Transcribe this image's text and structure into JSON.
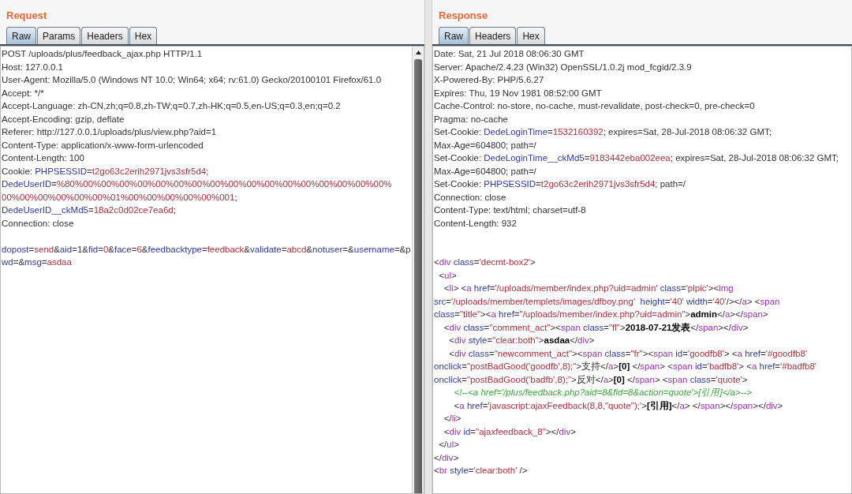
{
  "panels": [
    {
      "title": "Request",
      "has_scrollbar": true,
      "tabs": [
        {
          "label": "Raw",
          "selected": true
        },
        {
          "label": "Params",
          "selected": false
        },
        {
          "label": "Headers",
          "selected": false
        },
        {
          "label": "Hex",
          "selected": false
        }
      ],
      "lines": [
        {
          "kind": "code",
          "segments": [
            {
              "kind": "plain",
              "text": "POST /uploads/plus/feedback_ajax.php HTTP/1.1"
            }
          ]
        },
        {
          "kind": "code",
          "segments": [
            {
              "kind": "plain",
              "text": "Host: 127.0.0.1"
            }
          ]
        },
        {
          "kind": "code",
          "segments": [
            {
              "kind": "plain",
              "text": "User-Agent: Mozilla/5.0 (Windows NT 10.0; Win64; x64; rv:61.0) Gecko/20100101 Firefox/61.0"
            }
          ]
        },
        {
          "kind": "code",
          "segments": [
            {
              "kind": "plain",
              "text": "Accept: */*"
            }
          ]
        },
        {
          "kind": "code",
          "segments": [
            {
              "kind": "plain",
              "text": "Accept-Language: zh-CN,zh;q=0.8,zh-TW;q=0.7,zh-HK;q=0.5,en-US;q=0.3,en;q=0.2"
            }
          ]
        },
        {
          "kind": "code",
          "segments": [
            {
              "kind": "plain",
              "text": "Accept-Encoding: gzip, deflate"
            }
          ]
        },
        {
          "kind": "code",
          "segments": [
            {
              "kind": "plain",
              "text": "Referer: http://127.0.0.1/uploads/plus/view.php?aid=1"
            }
          ]
        },
        {
          "kind": "code",
          "segments": [
            {
              "kind": "plain",
              "text": "Content-Type: application/x-www-form-urlencoded"
            }
          ]
        },
        {
          "kind": "code",
          "segments": [
            {
              "kind": "plain",
              "text": "Content-Length: 100"
            }
          ]
        },
        {
          "kind": "code",
          "segments": [
            {
              "kind": "plain",
              "text": "Cookie: "
            },
            {
              "kind": "name",
              "text": "PHPSESSID"
            },
            {
              "kind": "plain",
              "text": "="
            },
            {
              "kind": "value",
              "text": "t2go63c2erih2971jvs3sfr5d4"
            },
            {
              "kind": "plain",
              "text": ";"
            }
          ]
        },
        {
          "kind": "code",
          "segments": [
            {
              "kind": "name",
              "text": "DedeUserID"
            },
            {
              "kind": "plain",
              "text": "="
            },
            {
              "kind": "value",
              "text": "%80%00%00%00%00%00%00%00%00%00%00%00%00%00%00%00%00%00%"
            }
          ]
        },
        {
          "kind": "code",
          "segments": [
            {
              "kind": "value",
              "text": "00%00%00%00%00%00%01%00%00%00%00%00%001"
            },
            {
              "kind": "plain",
              "text": ";"
            }
          ]
        },
        {
          "kind": "code",
          "segments": [
            {
              "kind": "name",
              "text": "DedeUserID__ckMd5"
            },
            {
              "kind": "plain",
              "text": "="
            },
            {
              "kind": "value",
              "text": "18a2c0d02ce7ea6d"
            },
            {
              "kind": "plain",
              "text": ";"
            }
          ]
        },
        {
          "kind": "code",
          "segments": [
            {
              "kind": "plain",
              "text": "Connection: close"
            }
          ]
        },
        {
          "kind": "blank"
        },
        {
          "kind": "code",
          "segments": [
            {
              "kind": "name",
              "text": "dopost"
            },
            {
              "kind": "plain",
              "text": "="
            },
            {
              "kind": "value",
              "text": "send"
            },
            {
              "kind": "plain",
              "text": "&"
            },
            {
              "kind": "name",
              "text": "aid"
            },
            {
              "kind": "plain",
              "text": "=1&"
            },
            {
              "kind": "name",
              "text": "fid"
            },
            {
              "kind": "plain",
              "text": "="
            },
            {
              "kind": "value",
              "text": "0"
            },
            {
              "kind": "plain",
              "text": "&"
            },
            {
              "kind": "name",
              "text": "face"
            },
            {
              "kind": "plain",
              "text": "="
            },
            {
              "kind": "value",
              "text": "6"
            },
            {
              "kind": "plain",
              "text": "&"
            },
            {
              "kind": "name",
              "text": "feedbacktype"
            },
            {
              "kind": "plain",
              "text": "="
            },
            {
              "kind": "value",
              "text": "feedback"
            },
            {
              "kind": "plain",
              "text": "&"
            },
            {
              "kind": "name",
              "text": "validate"
            },
            {
              "kind": "plain",
              "text": "="
            },
            {
              "kind": "value",
              "text": "abcd"
            },
            {
              "kind": "plain",
              "text": "&"
            },
            {
              "kind": "name",
              "text": "notuser"
            },
            {
              "kind": "plain",
              "text": "=&"
            },
            {
              "kind": "name",
              "text": "username"
            },
            {
              "kind": "plain",
              "text": "=&"
            },
            {
              "kind": "name",
              "text": "p"
            }
          ]
        },
        {
          "kind": "code",
          "segments": [
            {
              "kind": "name",
              "text": "wd"
            },
            {
              "kind": "plain",
              "text": "=&"
            },
            {
              "kind": "name",
              "text": "msg"
            },
            {
              "kind": "plain",
              "text": "="
            },
            {
              "kind": "value",
              "text": "asdaa"
            }
          ]
        }
      ]
    },
    {
      "title": "Response",
      "has_scrollbar": false,
      "tabs": [
        {
          "label": "Raw",
          "selected": true
        },
        {
          "label": "Headers",
          "selected": false
        },
        {
          "label": "Hex",
          "selected": false
        }
      ],
      "lines": [
        {
          "kind": "code",
          "segments": [
            {
              "kind": "plain",
              "text": "Date: Sat, 21 Jul 2018 08:06:30 GMT"
            }
          ]
        },
        {
          "kind": "code",
          "segments": [
            {
              "kind": "plain",
              "text": "Server: Apache/2.4.23 (Win32) OpenSSL/1.0.2j mod_fcgid/2.3.9"
            }
          ]
        },
        {
          "kind": "code",
          "segments": [
            {
              "kind": "plain",
              "text": "X-Powered-By: PHP/5.6.27"
            }
          ]
        },
        {
          "kind": "code",
          "segments": [
            {
              "kind": "plain",
              "text": "Expires: Thu, 19 Nov 1981 08:52:00 GMT"
            }
          ]
        },
        {
          "kind": "code",
          "segments": [
            {
              "kind": "plain",
              "text": "Cache-Control: no-store, no-cache, must-revalidate, post-check=0, pre-check=0"
            }
          ]
        },
        {
          "kind": "code",
          "segments": [
            {
              "kind": "plain",
              "text": "Pragma: no-cache"
            }
          ]
        },
        {
          "kind": "code",
          "segments": [
            {
              "kind": "plain",
              "text": "Set-Cookie: "
            },
            {
              "kind": "name",
              "text": "DedeLoginTime"
            },
            {
              "kind": "plain",
              "text": "="
            },
            {
              "kind": "value",
              "text": "1532160392"
            },
            {
              "kind": "plain",
              "text": "; expires=Sat, 28-Jul-2018 08:06:32 GMT;"
            }
          ]
        },
        {
          "kind": "code",
          "segments": [
            {
              "kind": "plain",
              "text": "Max-Age=604800; path=/"
            }
          ]
        },
        {
          "kind": "code",
          "segments": [
            {
              "kind": "plain",
              "text": "Set-Cookie: "
            },
            {
              "kind": "name",
              "text": "DedeLoginTime__ckMd5"
            },
            {
              "kind": "plain",
              "text": "="
            },
            {
              "kind": "value",
              "text": "9183442eba002eea"
            },
            {
              "kind": "plain",
              "text": "; expires=Sat, 28-Jul-2018 08:06:32 GMT;"
            }
          ]
        },
        {
          "kind": "code",
          "segments": [
            {
              "kind": "plain",
              "text": "Max-Age=604800; path=/"
            }
          ]
        },
        {
          "kind": "code",
          "segments": [
            {
              "kind": "plain",
              "text": "Set-Cookie: "
            },
            {
              "kind": "name",
              "text": "PHPSESSID"
            },
            {
              "kind": "plain",
              "text": "="
            },
            {
              "kind": "value",
              "text": "t2go63c2erih2971jvs3sfr5d4"
            },
            {
              "kind": "plain",
              "text": "; path=/"
            }
          ]
        },
        {
          "kind": "code",
          "segments": [
            {
              "kind": "plain",
              "text": "Connection: close"
            }
          ]
        },
        {
          "kind": "code",
          "segments": [
            {
              "kind": "plain",
              "text": "Content-Type: text/html; charset=utf-8"
            }
          ]
        },
        {
          "kind": "code",
          "segments": [
            {
              "kind": "plain",
              "text": "Content-Length: 932"
            }
          ]
        },
        {
          "kind": "blank"
        },
        {
          "kind": "blank"
        },
        {
          "kind": "code",
          "segments": [
            {
              "kind": "plain",
              "text": "<"
            },
            {
              "kind": "tag",
              "text": "div "
            },
            {
              "kind": "attr",
              "text": "class"
            },
            {
              "kind": "plain",
              "text": "="
            },
            {
              "kind": "value",
              "text": "'decmt-box2'"
            },
            {
              "kind": "plain",
              "text": ">"
            }
          ]
        },
        {
          "kind": "code",
          "segments": [
            {
              "kind": "plain",
              "text": "  <"
            },
            {
              "kind": "tag",
              "text": "ul"
            },
            {
              "kind": "plain",
              "text": ">"
            }
          ]
        },
        {
          "kind": "code",
          "segments": [
            {
              "kind": "plain",
              "text": "    <"
            },
            {
              "kind": "tag",
              "text": "li"
            },
            {
              "kind": "plain",
              "text": "> <"
            },
            {
              "kind": "tag",
              "text": "a "
            },
            {
              "kind": "attr",
              "text": "href"
            },
            {
              "kind": "plain",
              "text": "="
            },
            {
              "kind": "value",
              "text": "'/uploads/member/index.php?uid=admin' "
            },
            {
              "kind": "attr",
              "text": "class"
            },
            {
              "kind": "plain",
              "text": "="
            },
            {
              "kind": "value",
              "text": "'plpic'"
            },
            {
              "kind": "plain",
              "text": "><"
            },
            {
              "kind": "tag",
              "text": "img"
            }
          ]
        },
        {
          "kind": "code",
          "segments": [
            {
              "kind": "attr",
              "text": "src"
            },
            {
              "kind": "plain",
              "text": "="
            },
            {
              "kind": "value",
              "text": "'/uploads/member/templets/images/dfboy.png'  "
            },
            {
              "kind": "attr",
              "text": "height"
            },
            {
              "kind": "plain",
              "text": "="
            },
            {
              "kind": "value",
              "text": "'40' "
            },
            {
              "kind": "attr",
              "text": "width"
            },
            {
              "kind": "plain",
              "text": "="
            },
            {
              "kind": "value",
              "text": "'40'"
            },
            {
              "kind": "plain",
              "text": "/></"
            },
            {
              "kind": "tag",
              "text": "a"
            },
            {
              "kind": "plain",
              "text": "> <"
            },
            {
              "kind": "tag",
              "text": "span"
            }
          ]
        },
        {
          "kind": "code",
          "segments": [
            {
              "kind": "attr",
              "text": "class"
            },
            {
              "kind": "plain",
              "text": "="
            },
            {
              "kind": "value",
              "text": "\"title\""
            },
            {
              "kind": "plain",
              "text": "><"
            },
            {
              "kind": "tag",
              "text": "a "
            },
            {
              "kind": "attr",
              "text": "href"
            },
            {
              "kind": "plain",
              "text": "="
            },
            {
              "kind": "value",
              "text": "\"/uploads/member/index.php?uid=admin\""
            },
            {
              "kind": "plain",
              "text": ">"
            },
            {
              "kind": "bold",
              "text": "admin"
            },
            {
              "kind": "plain",
              "text": "</"
            },
            {
              "kind": "tag",
              "text": "a"
            },
            {
              "kind": "plain",
              "text": "></"
            },
            {
              "kind": "tag",
              "text": "span"
            },
            {
              "kind": "plain",
              "text": ">"
            }
          ]
        },
        {
          "kind": "code",
          "segments": [
            {
              "kind": "plain",
              "text": "    <"
            },
            {
              "kind": "tag",
              "text": "div "
            },
            {
              "kind": "attr",
              "text": "class"
            },
            {
              "kind": "plain",
              "text": "="
            },
            {
              "kind": "value",
              "text": "\"comment_act\""
            },
            {
              "kind": "plain",
              "text": "><"
            },
            {
              "kind": "tag",
              "text": "span "
            },
            {
              "kind": "attr",
              "text": "class"
            },
            {
              "kind": "plain",
              "text": "="
            },
            {
              "kind": "value",
              "text": "\"fl\""
            },
            {
              "kind": "plain",
              "text": ">"
            },
            {
              "kind": "bold",
              "text": "2018-07-21发表"
            },
            {
              "kind": "plain",
              "text": "</"
            },
            {
              "kind": "tag",
              "text": "span"
            },
            {
              "kind": "plain",
              "text": "></"
            },
            {
              "kind": "tag",
              "text": "div"
            },
            {
              "kind": "plain",
              "text": ">"
            }
          ]
        },
        {
          "kind": "code",
          "segments": [
            {
              "kind": "plain",
              "text": "      <"
            },
            {
              "kind": "tag",
              "text": "div "
            },
            {
              "kind": "attr",
              "text": "style"
            },
            {
              "kind": "plain",
              "text": "="
            },
            {
              "kind": "value",
              "text": "\"clear:both\""
            },
            {
              "kind": "plain",
              "text": ">"
            },
            {
              "kind": "bold",
              "text": "asdaa"
            },
            {
              "kind": "plain",
              "text": "</"
            },
            {
              "kind": "tag",
              "text": "div"
            },
            {
              "kind": "plain",
              "text": ">"
            }
          ]
        },
        {
          "kind": "code",
          "segments": [
            {
              "kind": "plain",
              "text": "      <"
            },
            {
              "kind": "tag",
              "text": "div "
            },
            {
              "kind": "attr",
              "text": "class"
            },
            {
              "kind": "plain",
              "text": "="
            },
            {
              "kind": "value",
              "text": "\"newcomment_act\""
            },
            {
              "kind": "plain",
              "text": "><"
            },
            {
              "kind": "tag",
              "text": "span "
            },
            {
              "kind": "attr",
              "text": "class"
            },
            {
              "kind": "plain",
              "text": "="
            },
            {
              "kind": "value",
              "text": "\"fr\""
            },
            {
              "kind": "plain",
              "text": "><"
            },
            {
              "kind": "tag",
              "text": "span "
            },
            {
              "kind": "attr",
              "text": "id"
            },
            {
              "kind": "plain",
              "text": "="
            },
            {
              "kind": "value",
              "text": "'goodfb8'"
            },
            {
              "kind": "plain",
              "text": "> <"
            },
            {
              "kind": "tag",
              "text": "a "
            },
            {
              "kind": "attr",
              "text": "href"
            },
            {
              "kind": "plain",
              "text": "="
            },
            {
              "kind": "value",
              "text": "'#goodfb8'"
            }
          ]
        },
        {
          "kind": "code",
          "segments": [
            {
              "kind": "attr",
              "text": "onclick"
            },
            {
              "kind": "plain",
              "text": "="
            },
            {
              "kind": "value",
              "text": "\"postBadGood('goodfb',8);\""
            },
            {
              "kind": "plain",
              "text": ">支持</"
            },
            {
              "kind": "tag",
              "text": "a"
            },
            {
              "kind": "plain",
              "text": ">"
            },
            {
              "kind": "bold",
              "text": "[0]"
            },
            {
              "kind": "plain",
              "text": " </"
            },
            {
              "kind": "tag",
              "text": "span"
            },
            {
              "kind": "plain",
              "text": "> <"
            },
            {
              "kind": "tag",
              "text": "span "
            },
            {
              "kind": "attr",
              "text": "id"
            },
            {
              "kind": "plain",
              "text": "="
            },
            {
              "kind": "value",
              "text": "'badfb8'"
            },
            {
              "kind": "plain",
              "text": "> <"
            },
            {
              "kind": "tag",
              "text": "a "
            },
            {
              "kind": "attr",
              "text": "href"
            },
            {
              "kind": "plain",
              "text": "="
            },
            {
              "kind": "value",
              "text": "'#badfb8'"
            }
          ]
        },
        {
          "kind": "code",
          "segments": [
            {
              "kind": "attr",
              "text": "onclick"
            },
            {
              "kind": "plain",
              "text": "="
            },
            {
              "kind": "value",
              "text": "\"postBadGood('badfb',8);\""
            },
            {
              "kind": "plain",
              "text": ">反对</"
            },
            {
              "kind": "tag",
              "text": "a"
            },
            {
              "kind": "plain",
              "text": ">"
            },
            {
              "kind": "bold",
              "text": "[0]"
            },
            {
              "kind": "plain",
              "text": " </"
            },
            {
              "kind": "tag",
              "text": "span"
            },
            {
              "kind": "plain",
              "text": "> <"
            },
            {
              "kind": "tag",
              "text": "span "
            },
            {
              "kind": "attr",
              "text": "class"
            },
            {
              "kind": "plain",
              "text": "="
            },
            {
              "kind": "value",
              "text": "'quote'"
            },
            {
              "kind": "plain",
              "text": ">"
            }
          ]
        },
        {
          "kind": "code",
          "segments": [
            {
              "kind": "comment",
              "text": "        <!--<a href='/plus/feedback.php?aid=8&fid=8&action=quote'>[引用]</a>-->"
            }
          ]
        },
        {
          "kind": "code",
          "segments": [
            {
              "kind": "plain",
              "text": "        <"
            },
            {
              "kind": "tag",
              "text": "a "
            },
            {
              "kind": "attr",
              "text": "href"
            },
            {
              "kind": "plain",
              "text": "="
            },
            {
              "kind": "value",
              "text": "'javascript:ajaxFeedback(8,8,\"quote\");'"
            },
            {
              "kind": "plain",
              "text": ">"
            },
            {
              "kind": "bold",
              "text": "[引用]"
            },
            {
              "kind": "plain",
              "text": "</"
            },
            {
              "kind": "tag",
              "text": "a"
            },
            {
              "kind": "plain",
              "text": "> </"
            },
            {
              "kind": "tag",
              "text": "span"
            },
            {
              "kind": "plain",
              "text": "></"
            },
            {
              "kind": "tag",
              "text": "span"
            },
            {
              "kind": "plain",
              "text": "></"
            },
            {
              "kind": "tag",
              "text": "div"
            },
            {
              "kind": "plain",
              "text": ">"
            }
          ]
        },
        {
          "kind": "code",
          "segments": [
            {
              "kind": "plain",
              "text": "    </"
            },
            {
              "kind": "tag",
              "text": "li"
            },
            {
              "kind": "plain",
              "text": ">"
            }
          ]
        },
        {
          "kind": "code",
          "segments": [
            {
              "kind": "plain",
              "text": "    <"
            },
            {
              "kind": "tag",
              "text": "div "
            },
            {
              "kind": "attr",
              "text": "id"
            },
            {
              "kind": "plain",
              "text": "="
            },
            {
              "kind": "value",
              "text": "\"ajaxfeedback_8\""
            },
            {
              "kind": "plain",
              "text": "></"
            },
            {
              "kind": "tag",
              "text": "div"
            },
            {
              "kind": "plain",
              "text": ">"
            }
          ]
        },
        {
          "kind": "code",
          "segments": [
            {
              "kind": "plain",
              "text": "  </"
            },
            {
              "kind": "tag",
              "text": "ul"
            },
            {
              "kind": "plain",
              "text": ">"
            }
          ]
        },
        {
          "kind": "code",
          "segments": [
            {
              "kind": "plain",
              "text": "</"
            },
            {
              "kind": "tag",
              "text": "div"
            },
            {
              "kind": "plain",
              "text": ">"
            }
          ]
        },
        {
          "kind": "code",
          "segments": [
            {
              "kind": "plain",
              "text": "<"
            },
            {
              "kind": "tag",
              "text": "br "
            },
            {
              "kind": "attr",
              "text": "style"
            },
            {
              "kind": "plain",
              "text": "="
            },
            {
              "kind": "value",
              "text": "'clear:both'"
            },
            {
              "kind": "plain",
              "text": " />"
            }
          ]
        }
      ]
    }
  ]
}
